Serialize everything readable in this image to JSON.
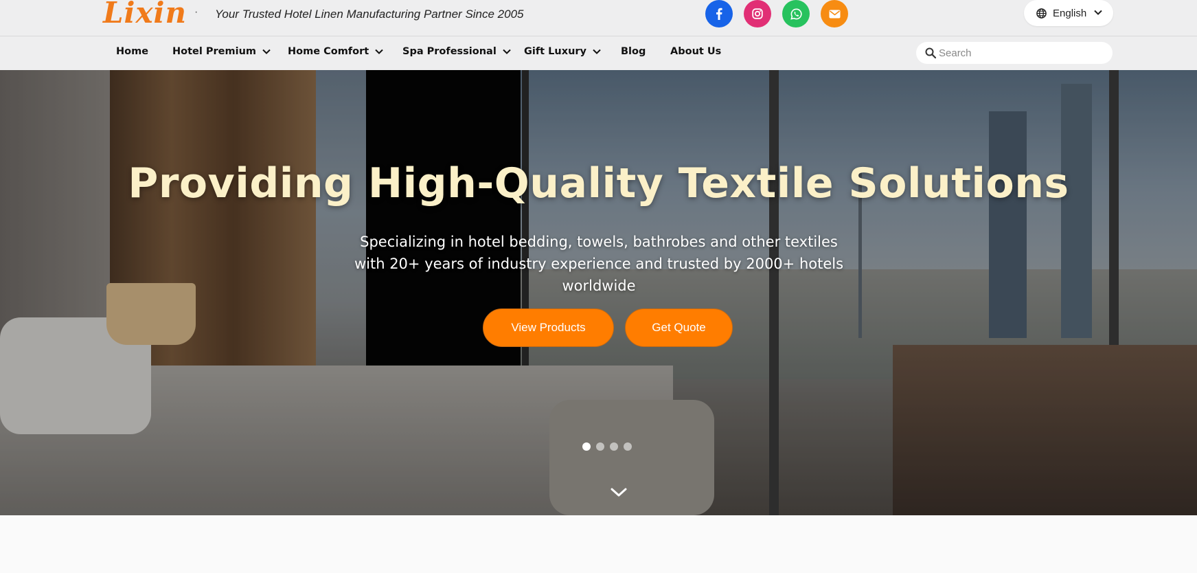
{
  "header": {
    "logo": "Lixin",
    "separator": "·",
    "tagline": "Your Trusted Hotel Linen Manufacturing Partner Since 2005",
    "social": [
      {
        "name": "facebook-icon",
        "color": "#1763e8"
      },
      {
        "name": "instagram-icon",
        "color": "#e12f75"
      },
      {
        "name": "whatsapp-icon",
        "color": "#27c25e"
      },
      {
        "name": "email-icon",
        "color": "#f78c12"
      }
    ],
    "language": {
      "label": "English",
      "icon": "globe-icon"
    }
  },
  "nav": {
    "items": [
      {
        "label": "Home",
        "dropdown": false
      },
      {
        "label": "Hotel Premium",
        "dropdown": true
      },
      {
        "label": "Home Comfort",
        "dropdown": true
      },
      {
        "label": "Spa Professional",
        "dropdown": true
      },
      {
        "label": "Gift Luxury",
        "dropdown": true
      },
      {
        "label": "Blog",
        "dropdown": false
      },
      {
        "label": "About Us",
        "dropdown": false
      }
    ],
    "search": {
      "placeholder": "Search",
      "value": ""
    }
  },
  "hero": {
    "title": "Providing High-Quality Textile Solutions",
    "subtitle": "Specializing in hotel bedding, towels, bathrobes and other textiles with 20+ years of industry experience and trusted by 2000+ hotels worldwide",
    "buttons": {
      "primary": "View Products",
      "secondary": "Get Quote"
    },
    "carousel": {
      "slides": 4,
      "active": 1
    },
    "colors": {
      "accent": "#ff7d00",
      "title": "#fbf0c8"
    }
  }
}
